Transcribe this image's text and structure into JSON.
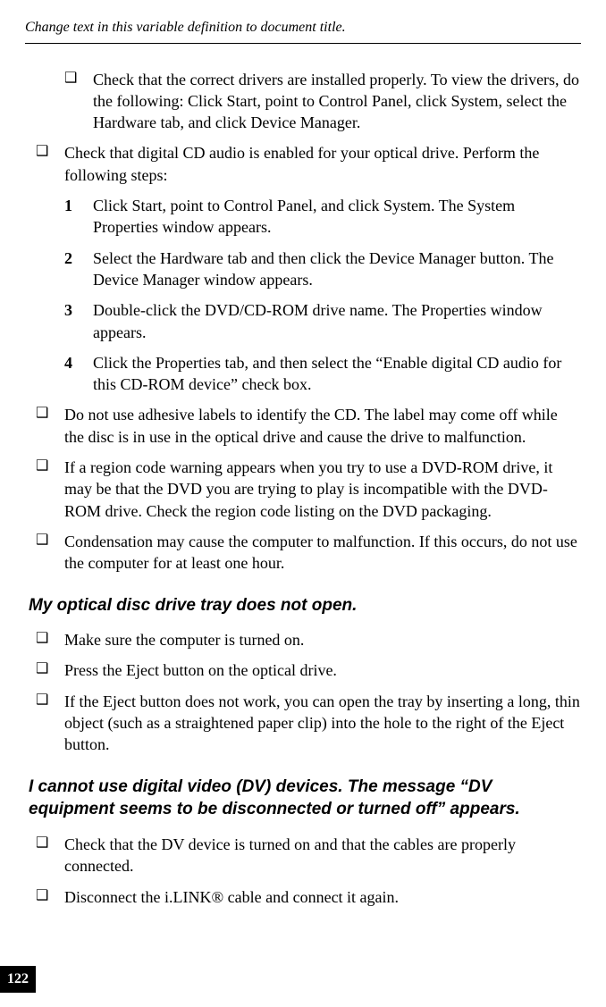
{
  "header": "Change text in this variable definition to document title.",
  "page_number": "122",
  "top_sub_bullet": "Check that the correct drivers are installed properly. To view the drivers, do the following: Click Start, point to Control Panel, click System, select the Hardware tab, and click Device Manager.",
  "bullet_check_audio": "Check that digital CD audio is enabled for your optical drive. Perform the following steps:",
  "steps": {
    "s1_num": "1",
    "s1_text": "Click Start, point to Control Panel, and click System. The System Properties window appears.",
    "s2_num": "2",
    "s2_text": "Select the Hardware tab and then click the Device Manager button. The Device Manager window appears.",
    "s3_num": "3",
    "s3_text": "Double-click the DVD/CD-ROM drive name. The Properties window appears.",
    "s4_num": "4",
    "s4_text": "Click the Properties tab, and then select the “Enable digital CD audio for this CD-ROM device” check box."
  },
  "bullet_labels": "Do not use adhesive labels to identify the CD. The label may come off while the disc is in use in the optical drive and cause the drive to malfunction.",
  "bullet_region": "If a region code warning appears when you try to use a DVD-ROM drive, it may be that the DVD you are trying to play is incompatible with the DVD-ROM drive. Check the region code listing on the DVD packaging.",
  "bullet_condensation": "Condensation may cause the computer to malfunction. If this occurs, do not use the computer for at least one hour.",
  "section_tray": "My optical disc drive tray does not open.",
  "tray_b1": "Make sure the computer is turned on.",
  "tray_b2": "Press the Eject button on the optical drive.",
  "tray_b3": "If the Eject button does not work, you can open the tray by inserting a long, thin object (such as a straightened paper clip) into the hole to the right of the Eject button.",
  "section_dv": "I cannot use digital video (DV) devices. The message “DV equipment seems to be disconnected or turned off” appears.",
  "dv_b1": "Check that the DV device is turned on and that the cables are properly connected.",
  "dv_b2": "Disconnect the i.LINK® cable and connect it again."
}
